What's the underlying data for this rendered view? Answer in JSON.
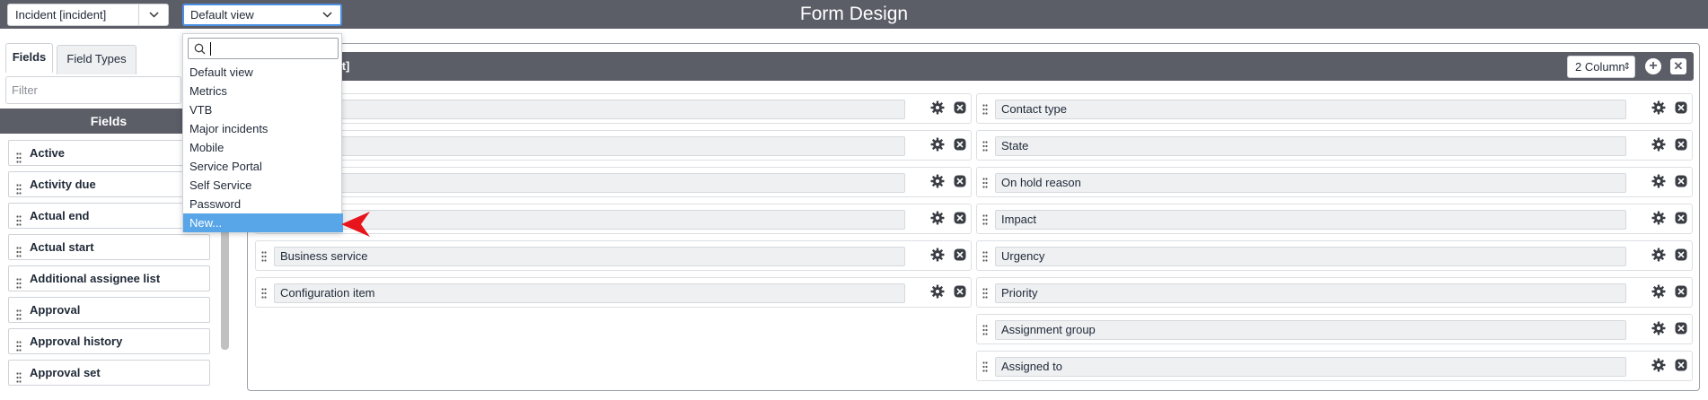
{
  "header": {
    "title": "Form Design",
    "table_select": "Incident [incident]",
    "view_select": "Default view"
  },
  "left_panel": {
    "tabs": [
      "Fields",
      "Field Types"
    ],
    "filter_placeholder": "Filter",
    "fields_heading": "Fields",
    "fields": [
      "Active",
      "Activity due",
      "Actual end",
      "Actual start",
      "Additional assignee list",
      "Approval",
      "Approval history",
      "Approval set"
    ]
  },
  "section": {
    "title": "ident]",
    "columns_select": "2 Column"
  },
  "left_column": [
    {
      "label": ""
    },
    {
      "label": ""
    },
    {
      "label": ""
    },
    {
      "label": ""
    },
    {
      "label": "Business service"
    },
    {
      "label": "Configuration item"
    }
  ],
  "right_column": [
    {
      "label": "Contact type"
    },
    {
      "label": "State"
    },
    {
      "label": "On hold reason"
    },
    {
      "label": "Impact"
    },
    {
      "label": "Urgency"
    },
    {
      "label": "Priority"
    },
    {
      "label": "Assignment group"
    },
    {
      "label": "Assigned to"
    }
  ],
  "dropdown": {
    "search_value": "",
    "items": [
      "Default view",
      "Metrics",
      "VTB",
      "Major incidents",
      "Mobile",
      "Service Portal",
      "Self Service",
      "Password",
      "New..."
    ],
    "highlighted": "New..."
  },
  "colors": {
    "header_bg": "#5b5d67",
    "highlight": "#58a6e8",
    "arrow": "#e8141c"
  }
}
